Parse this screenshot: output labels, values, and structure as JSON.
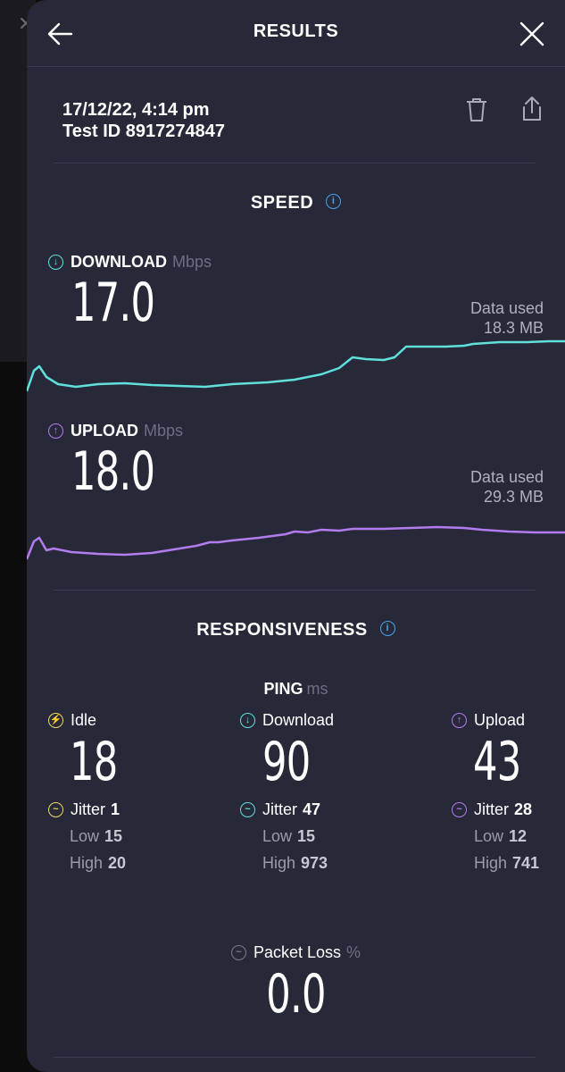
{
  "header": {
    "title": "RESULTS"
  },
  "meta": {
    "datetime": "17/12/22, 4:14 pm",
    "test_id": "Test ID 8917274847"
  },
  "speed": {
    "title": "SPEED",
    "download": {
      "label": "DOWNLOAD",
      "unit": "Mbps",
      "value": "17.0",
      "data_used_label": "Data used",
      "data_used": "18.3 MB"
    },
    "upload": {
      "label": "UPLOAD",
      "unit": "Mbps",
      "value": "18.0",
      "data_used_label": "Data used",
      "data_used": "29.3 MB"
    }
  },
  "responsiveness": {
    "title": "RESPONSIVENESS",
    "ping_label": "PING",
    "ping_unit": "ms",
    "idle": {
      "label": "Idle",
      "value": "18",
      "jitter_label": "Jitter",
      "jitter": "1",
      "low_label": "Low",
      "low": "15",
      "high_label": "High",
      "high": "20"
    },
    "download": {
      "label": "Download",
      "value": "90",
      "jitter_label": "Jitter",
      "jitter": "47",
      "low_label": "Low",
      "low": "15",
      "high_label": "High",
      "high": "973"
    },
    "upload": {
      "label": "Upload",
      "value": "43",
      "jitter_label": "Jitter",
      "jitter": "28",
      "low_label": "Low",
      "low": "12",
      "high_label": "High",
      "high": "741"
    }
  },
  "packet_loss": {
    "label": "Packet Loss",
    "unit": "%",
    "value": "0.0"
  },
  "colors": {
    "download": "#5fe0dc",
    "upload": "#b27cf0",
    "idle": "#ecd86a",
    "info": "#4aa3ea",
    "panel": "#272838"
  }
}
